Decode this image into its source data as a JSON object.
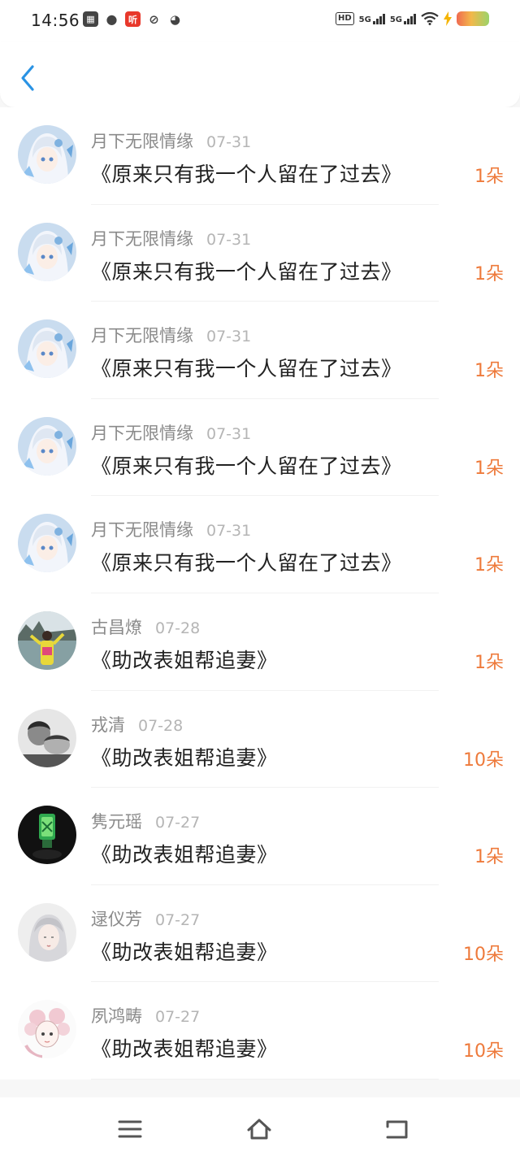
{
  "status_bar": {
    "time": "14:56",
    "icons": [
      "app-grid-icon",
      "wechat-icon",
      "ting-icon",
      "link-app-icon",
      "cat-app-icon"
    ],
    "ting_label": "听",
    "network": [
      "HD",
      "5G",
      "5G"
    ]
  },
  "header": {
    "back_icon": "chevron-left-icon"
  },
  "list": {
    "rows": [
      {
        "name": "月下无限情缘",
        "date": "07-31",
        "title": "《原来只有我一个人留在了过去》",
        "gift": "1朵",
        "avatar": "anime-girl-blue"
      },
      {
        "name": "月下无限情缘",
        "date": "07-31",
        "title": "《原来只有我一个人留在了过去》",
        "gift": "1朵",
        "avatar": "anime-girl-blue"
      },
      {
        "name": "月下无限情缘",
        "date": "07-31",
        "title": "《原来只有我一个人留在了过去》",
        "gift": "1朵",
        "avatar": "anime-girl-blue"
      },
      {
        "name": "月下无限情缘",
        "date": "07-31",
        "title": "《原来只有我一个人留在了过去》",
        "gift": "1朵",
        "avatar": "anime-girl-blue"
      },
      {
        "name": "月下无限情缘",
        "date": "07-31",
        "title": "《原来只有我一个人留在了过去》",
        "gift": "1朵",
        "avatar": "anime-girl-blue"
      },
      {
        "name": "古昌燎",
        "date": "07-28",
        "title": "《助改表姐帮追妻》",
        "gift": "1朵",
        "avatar": "photo-person-lake"
      },
      {
        "name": "戎清",
        "date": "07-28",
        "title": "《助改表姐帮追妻》",
        "gift": "10朵",
        "avatar": "photo-bw-couple"
      },
      {
        "name": "隽元瑶",
        "date": "07-27",
        "title": "《助改表姐帮追妻》",
        "gift": "1朵",
        "avatar": "photo-green-jade"
      },
      {
        "name": "逯仪芳",
        "date": "07-27",
        "title": "《助改表姐帮追妻》",
        "gift": "10朵",
        "avatar": "illustration-silver-hair"
      },
      {
        "name": "夙鸿畴",
        "date": "07-27",
        "title": "《助改表姐帮追妻》",
        "gift": "10朵",
        "avatar": "sketch-pink-girl"
      }
    ]
  },
  "bottom_nav": {
    "buttons": [
      "menu-icon",
      "home-icon",
      "back-icon"
    ]
  },
  "colors": {
    "accent_blue": "#1e88e5",
    "gift_orange": "#ee7a3b",
    "name_gray": "#8a8a8a",
    "date_gray": "#b5b5b5",
    "title_black": "#222222"
  }
}
